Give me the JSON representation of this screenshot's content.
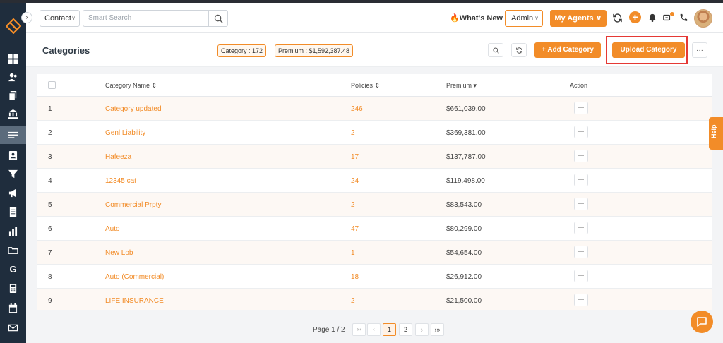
{
  "topbar": {
    "contact_label": "Contact",
    "search_placeholder": "Smart Search",
    "whats_new": "What's New",
    "admin_label": "Admin",
    "my_agents": "My Agents"
  },
  "header": {
    "title": "Categories",
    "category_badge": "Category : 172",
    "premium_badge": "Premium : $1,592,387.48",
    "add_category": "+ Add Category",
    "upload_category": "Upload Category",
    "more": "···"
  },
  "table": {
    "columns": {
      "name": "Category Name ⇕",
      "policies": "Policies ⇕",
      "premium": "Premium ▾",
      "action": "Action"
    },
    "rows": [
      {
        "index": "1",
        "name": "Category updated",
        "policies": "246",
        "premium": "$661,039.00"
      },
      {
        "index": "2",
        "name": "Genl Liability",
        "policies": "2",
        "premium": "$369,381.00"
      },
      {
        "index": "3",
        "name": "Hafeeza",
        "policies": "17",
        "premium": "$137,787.00"
      },
      {
        "index": "4",
        "name": "12345 cat",
        "policies": "24",
        "premium": "$119,498.00"
      },
      {
        "index": "5",
        "name": "Commercial Prpty",
        "policies": "2",
        "premium": "$83,543.00"
      },
      {
        "index": "6",
        "name": "Auto",
        "policies": "47",
        "premium": "$80,299.00"
      },
      {
        "index": "7",
        "name": "New Lob",
        "policies": "1",
        "premium": "$54,654.00"
      },
      {
        "index": "8",
        "name": "Auto (Commercial)",
        "policies": "18",
        "premium": "$26,912.00"
      },
      {
        "index": "9",
        "name": "LIFE INSURANCE",
        "policies": "2",
        "premium": "$21,500.00"
      }
    ],
    "row_action": "···"
  },
  "pagination": {
    "info": "Page 1 / 2",
    "first": "«‹",
    "prev": "‹",
    "page1": "1",
    "page2": "2",
    "next": "›",
    "last": "›»"
  },
  "help": {
    "label": "Help"
  },
  "colors": {
    "accent": "#f28c28",
    "sidebar": "#1f2d3d",
    "highlight": "#e53935"
  }
}
